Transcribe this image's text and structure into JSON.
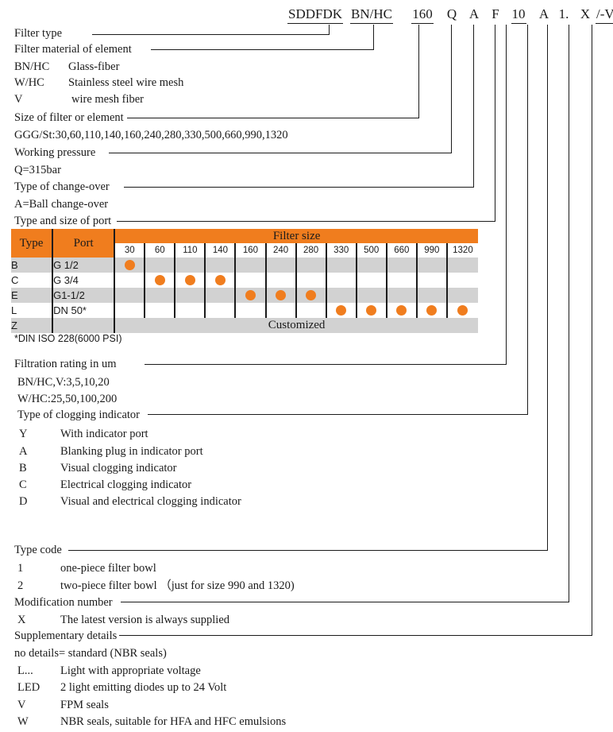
{
  "title": "Filter model code nomenclature",
  "colors": {
    "orange": "#F07D1E",
    "gray": "#D2D2D2",
    "line": "#1b1b1b"
  },
  "code": {
    "tokens": [
      {
        "text": "SDDFDK",
        "underline": true
      },
      {
        "text": "BN/HC",
        "underline": true
      },
      {
        "text": "160",
        "underline": true
      },
      {
        "text": "Q",
        "underline": false
      },
      {
        "text": "A",
        "underline": false
      },
      {
        "text": "F",
        "underline": false
      },
      {
        "text": "10",
        "underline": true
      },
      {
        "text": "A",
        "underline": false
      },
      {
        "text": "1.",
        "underline": false
      },
      {
        "text": "X",
        "underline": false
      },
      {
        "text": "/-V",
        "underline": true
      }
    ]
  },
  "sections": {
    "filter_type": "Filter type",
    "filter_material": "Filter material of element",
    "material_options": [
      {
        "code": "BN/HC",
        "desc": "Glass-fiber"
      },
      {
        "code": "W/HC",
        "desc": "Stainless steel wire mesh"
      },
      {
        "code": "V",
        "desc": "wire mesh fiber"
      }
    ],
    "size_of_filter": "Size of filter or element",
    "size_values": "GGG/St:30,60,110,140,160,240,280,330,500,660,990,1320",
    "working_pressure": "Working pressure",
    "pressure_value": "Q=315bar",
    "type_of_changeover": "Type of change-over",
    "changeover_value": "A=Ball change-over",
    "type_and_size_of_port": "Type and size of port",
    "din_note": "*DIN ISO 228(6000 PSI)",
    "filtration_rating": "Filtration rating in um",
    "filtration_values": [
      "BN/HC,V:3,5,10,20",
      "W/HC:25,50,100,200"
    ],
    "type_of_clogging_indicator": "Type of clogging indicator",
    "indicator_options": [
      {
        "code": "Y",
        "desc": "With indicator port"
      },
      {
        "code": "A",
        "desc": "Blanking plug in indicator port"
      },
      {
        "code": "B",
        "desc": "Visual clogging indicator"
      },
      {
        "code": "C",
        "desc": "Electrical clogging indicator"
      },
      {
        "code": "D",
        "desc": "Visual and electrical clogging indicator"
      }
    ],
    "type_code": "Type code",
    "type_code_options": [
      {
        "code": "1",
        "desc": "one-piece filter bowl"
      },
      {
        "code": "2",
        "desc": "two-piece filter bowl （just for size 990 and 1320)"
      }
    ],
    "modification_number": "Modification number",
    "modification_options": [
      {
        "code": "X",
        "desc": "The latest version is always supplied"
      }
    ],
    "supplementary_details": "Supplementary details",
    "supplementary_options": [
      {
        "code": "",
        "desc": "no details= standard (NBR seals)"
      },
      {
        "code": "L...",
        "desc": "Light with appropriate voltage"
      },
      {
        "code": "LED",
        "desc": "2 light emitting diodes up to 24 Volt"
      },
      {
        "code": "V",
        "desc": "FPM seals"
      },
      {
        "code": "W",
        "desc": "NBR seals, suitable for HFA and HFC emulsions"
      }
    ]
  },
  "chart_data": {
    "type": "table",
    "title": "Port type vs Filter size availability",
    "headers": {
      "type": "Type",
      "port": "Port",
      "filter_size": "Filter size"
    },
    "categories": [
      "30",
      "60",
      "110",
      "140",
      "160",
      "240",
      "280",
      "330",
      "500",
      "660",
      "990",
      "1320"
    ],
    "rows": [
      {
        "type": "B",
        "port": "G 1/2",
        "sizes": [
          1,
          0,
          0,
          0,
          0,
          0,
          0,
          0,
          0,
          0,
          0,
          0
        ]
      },
      {
        "type": "C",
        "port": "G 3/4",
        "sizes": [
          0,
          1,
          1,
          1,
          0,
          0,
          0,
          0,
          0,
          0,
          0,
          0
        ]
      },
      {
        "type": "E",
        "port": "G1-1/2",
        "sizes": [
          0,
          0,
          0,
          0,
          1,
          1,
          1,
          0,
          0,
          0,
          0,
          0
        ]
      },
      {
        "type": "L",
        "port": "DN 50*",
        "sizes": [
          0,
          0,
          0,
          0,
          0,
          0,
          0,
          1,
          1,
          1,
          1,
          1
        ]
      }
    ],
    "customized_row": {
      "type": "Z",
      "label": "Customized"
    }
  }
}
